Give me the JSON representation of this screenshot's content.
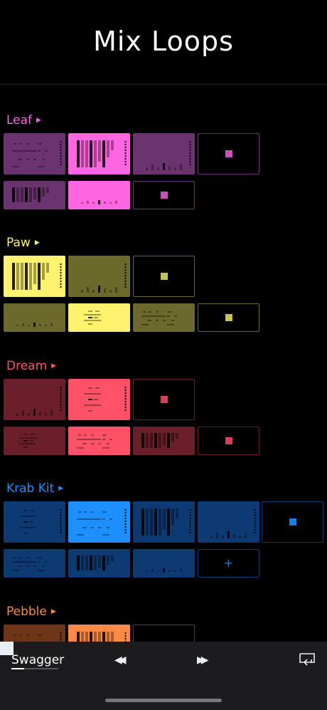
{
  "app": {
    "title": "Mix Loops"
  },
  "groups": [
    {
      "name": "Leaf",
      "color": "#ff66e1",
      "dim": "#6b3470",
      "stop": "#c752c0",
      "rows": [
        [
          "dim",
          "bright",
          "dim",
          "stop"
        ],
        [
          "dim",
          "bright",
          "stop"
        ]
      ]
    },
    {
      "name": "Paw",
      "color": "#fff26e",
      "dim": "#6b6a2c",
      "stop": "#c9c15a",
      "rows": [
        [
          "bright",
          "dim",
          "stop"
        ],
        [
          "dim",
          "bright",
          "dim",
          "stop"
        ]
      ]
    },
    {
      "name": "Dream",
      "color": "#ff5269",
      "dim": "#6a1f2a",
      "stop": "#d54157",
      "rows": [
        [
          "dim",
          "bright",
          "stop"
        ],
        [
          "dim",
          "bright",
          "dim",
          "stop"
        ]
      ]
    },
    {
      "name": "Krab Kit",
      "color": "#1e8fff",
      "dim": "#0d3a73",
      "stop": "#1a7fe0",
      "rows": [
        [
          "dim",
          "bright",
          "dim",
          "dim",
          "stop"
        ],
        [
          "dim",
          "dim",
          "dim",
          "plus"
        ]
      ]
    },
    {
      "name": "Pebble",
      "color": "#ff8a45",
      "dim": "#6e3618",
      "stop": "#d9723a",
      "rows": [
        [
          "dim",
          "bright",
          "stop"
        ]
      ]
    }
  ],
  "cell_plus_label": "+",
  "player": {
    "track": "Swagger",
    "rewind_glyph": "◀◀",
    "ffwd_glyph": "▶▶",
    "progress": 0.27
  }
}
